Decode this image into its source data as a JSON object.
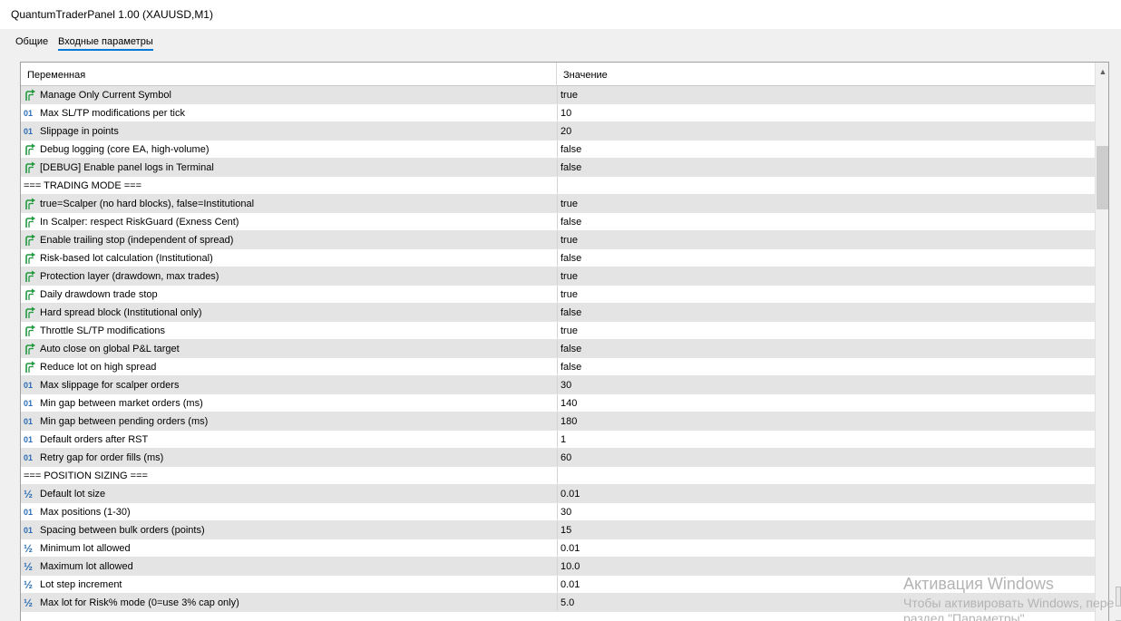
{
  "window": {
    "title": "QuantumTraderPanel 1.00 (XAUUSD,M1)"
  },
  "tabs": [
    {
      "label": "Общие"
    },
    {
      "label": "Входные параметры"
    }
  ],
  "table": {
    "col_variable": "Переменная",
    "col_value": "Значение",
    "rows": [
      {
        "icon": "bool-icon",
        "name": "Manage Only Current Symbol",
        "value": "true"
      },
      {
        "icon": "int-icon",
        "name": "Max SL/TP modifications per tick",
        "value": "10"
      },
      {
        "icon": "int-icon",
        "name": "Slippage in points",
        "value": "20"
      },
      {
        "icon": "bool-icon",
        "name": "Debug logging (core EA, high-volume)",
        "value": "false"
      },
      {
        "icon": "bool-icon",
        "name": "[DEBUG] Enable panel logs in Terminal",
        "value": "false"
      },
      {
        "icon": "none",
        "name": "=== TRADING MODE ===",
        "value": ""
      },
      {
        "icon": "bool-icon",
        "name": "true=Scalper (no hard blocks), false=Institutional",
        "value": "true"
      },
      {
        "icon": "bool-icon",
        "name": "In Scalper: respect RiskGuard (Exness Cent)",
        "value": "false"
      },
      {
        "icon": "bool-icon",
        "name": "Enable trailing stop (independent of spread)",
        "value": "true"
      },
      {
        "icon": "bool-icon",
        "name": "Risk-based lot calculation (Institutional)",
        "value": "false"
      },
      {
        "icon": "bool-icon",
        "name": "Protection layer (drawdown, max trades)",
        "value": "true"
      },
      {
        "icon": "bool-icon",
        "name": "Daily drawdown trade stop",
        "value": "true"
      },
      {
        "icon": "bool-icon",
        "name": "Hard spread block (Institutional only)",
        "value": "false"
      },
      {
        "icon": "bool-icon",
        "name": "Throttle SL/TP modifications",
        "value": "true"
      },
      {
        "icon": "bool-icon",
        "name": "Auto close on global P&L target",
        "value": "false"
      },
      {
        "icon": "bool-icon",
        "name": "Reduce lot on high spread",
        "value": "false"
      },
      {
        "icon": "int-icon",
        "name": "Max slippage for scalper orders",
        "value": "30"
      },
      {
        "icon": "int-icon",
        "name": "Min gap between market orders (ms)",
        "value": "140"
      },
      {
        "icon": "int-icon",
        "name": "Min gap between pending orders (ms)",
        "value": "180"
      },
      {
        "icon": "int-icon",
        "name": "Default orders after RST",
        "value": "1"
      },
      {
        "icon": "int-icon",
        "name": "Retry gap for order fills (ms)",
        "value": "60"
      },
      {
        "icon": "none",
        "name": "=== POSITION SIZING ===",
        "value": ""
      },
      {
        "icon": "double-icon",
        "name": "Default lot size",
        "value": "0.01"
      },
      {
        "icon": "int-icon",
        "name": "Max positions (1-30)",
        "value": "30"
      },
      {
        "icon": "int-icon",
        "name": "Spacing between bulk orders (points)",
        "value": "15"
      },
      {
        "icon": "double-icon",
        "name": "Minimum lot allowed",
        "value": "0.01"
      },
      {
        "icon": "double-icon",
        "name": "Maximum lot allowed",
        "value": "10.0"
      },
      {
        "icon": "double-icon",
        "name": "Lot step increment",
        "value": "0.01"
      },
      {
        "icon": "double-icon",
        "name": "Max lot for Risk% mode (0=use 3% cap only)",
        "value": "5.0"
      }
    ]
  },
  "watermark": {
    "line1": "Активация Windows",
    "line2": "Чтобы активировать Windows, пере",
    "line3": "раздел \"Параметры\"."
  },
  "icons": {
    "int_glyph": "01",
    "double_glyph": "½"
  },
  "colors": {
    "bool_icon": "#1f9a3f",
    "int_icon": "#2a6cb3",
    "tab_underline": "#0078d7",
    "row_alt": "#e4e4e4"
  }
}
